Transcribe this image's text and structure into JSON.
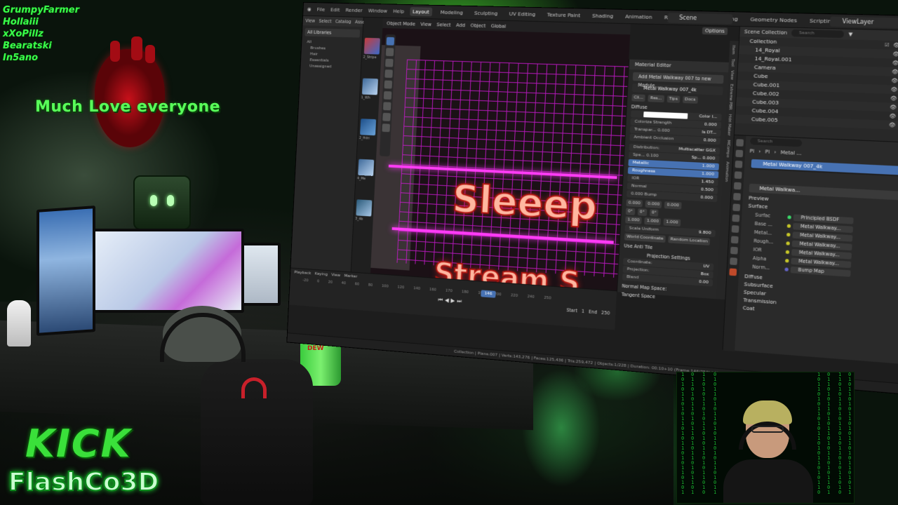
{
  "overlay": {
    "chat_names": [
      "GrumpyFarmer",
      "Hollaiii",
      "xXoPillz",
      "Bearatski",
      "In5ano"
    ],
    "love_text": "Much Love everyone",
    "logo_top": "KICK",
    "logo_bottom": "FlashCo3D"
  },
  "blender": {
    "menus": [
      "File",
      "Edit",
      "Render",
      "Window",
      "Help"
    ],
    "workspaces": [
      "Layout",
      "Modeling",
      "Sculpting",
      "UV Editing",
      "Texture Paint",
      "Shading",
      "Animation",
      "Rendering",
      "Compositing",
      "Geometry Nodes",
      "Scripting"
    ],
    "active_workspace": "Layout",
    "scene_name": "Scene",
    "view_layer": "ViewLayer",
    "asset_browser": {
      "header_items": [
        "View",
        "Select",
        "Catalog",
        "Asset"
      ],
      "library": "All Libraries",
      "catalogs": [
        {
          "label": "All",
          "indent": false
        },
        {
          "label": "Brushes",
          "indent": true
        },
        {
          "label": "Hair",
          "indent": true
        },
        {
          "label": "Essentials",
          "indent": true
        },
        {
          "label": "Unassigned",
          "indent": true
        }
      ],
      "thumbs": [
        "2_Stripe",
        "1_Wh",
        "2_Hdri",
        "4_Me",
        "3_Ab"
      ]
    },
    "viewport": {
      "header_items": [
        "Object Mode",
        "View",
        "Select",
        "Add",
        "Object"
      ],
      "transform": "Global",
      "options_label": "Options",
      "scene_text_1": "Sleeep",
      "scene_text_2": "Stream S"
    },
    "timeline": {
      "menus": [
        "Playback",
        "Keying",
        "View",
        "Marker"
      ],
      "ruler": [
        "-20",
        "0",
        "20",
        "40",
        "60",
        "80",
        "100",
        "120",
        "140",
        "160",
        "170",
        "180",
        "190",
        "200",
        "220",
        "240",
        "250"
      ],
      "current_frame": "146",
      "start_label": "Start",
      "start_value": "1",
      "end_label": "End",
      "end_value": "250"
    },
    "status_text": "Collection | Plane.007 | Verts:143,276 | Faces:125,436 | Tris:259,472 | Objects:1/228 | Duration: 00:10+10 (Frame 146/250) | Memory: 1.63 GiB | VRAM: 3.9/23.6 GiB | 4.5.1",
    "material_editor": {
      "title": "Material Editor",
      "add_button": "Add Metal Walkway 007 to new Module",
      "material_name": "Metal Walkway 007_4k",
      "chips": [
        "Cli...",
        "Res...",
        "Tips",
        "Docs"
      ],
      "diffuse_label": "Diffuse",
      "color_label": "Color I...",
      "colorize_label": "Colorize Strength",
      "colorize_value": "0.000",
      "transparency_label": "Transpar...",
      "transparency_value": "0.000",
      "is_dt_label": "Is DT...",
      "ao_label": "Ambient Occlusion",
      "ao_value": "0.000",
      "distribution_label": "Distribution:",
      "distribution_value": "Multiscatter GGX",
      "spec_label": "Spe...",
      "spec_value": "0.100",
      "sp_label": "Sp...",
      "sp_value": "0.000",
      "metallic_label": "Metallic",
      "metallic_value": "1.000",
      "roughness_label": "Roughness",
      "roughness_value": "1.000",
      "ior_label": "IOR",
      "ior_value": "1.450",
      "normal_label": "Normal",
      "normal_value": "0.500",
      "bump_label": "Bump",
      "bump_values": [
        "0.000",
        "0.000"
      ],
      "mapping_values": [
        "0.000",
        "0.000",
        "0.000",
        "0°",
        "0°",
        "0°",
        "1.000",
        "1.000",
        "1.000"
      ],
      "scale_uniform_label": "Scale Uniform",
      "scale_uniform_value": "9.800",
      "world_coord_label": "World Coordinate",
      "random_loc_label": "Random Location",
      "anti_tile_label": "Use Anti Tile",
      "projection_settings_label": "Projection Settings",
      "coordinate_label": "Coordinate:",
      "coordinate_value": "UV",
      "projection_label": "Projection:",
      "projection_value": "Box",
      "blend_label": "Blend",
      "blend_value": "0.00",
      "normal_map_space_label": "Normal Map Space:",
      "tangent_space_label": "Tangent Space"
    },
    "side_tabs": [
      "Item",
      "Tool",
      "View",
      "Extreme PBR",
      "Hdri Maker",
      "MCompo",
      "Animation"
    ],
    "outliner": {
      "title": "Scene Collection",
      "search_placeholder": "Search",
      "rows": [
        {
          "label": "Collection",
          "active": false
        },
        {
          "label": "14_Royal",
          "active": false
        },
        {
          "label": "14_Royal.001",
          "active": false
        },
        {
          "label": "Camera",
          "active": false
        },
        {
          "label": "Cube",
          "active": false
        },
        {
          "label": "Cube.001",
          "active": false
        },
        {
          "label": "Cube.002",
          "active": false
        },
        {
          "label": "Cube.003",
          "active": false
        },
        {
          "label": "Cube.004",
          "active": false
        },
        {
          "label": "Cube.005",
          "active": false
        }
      ]
    },
    "properties": {
      "search_placeholder": "Search",
      "path": [
        "Pl",
        "Pl",
        "Metal ..."
      ],
      "slot": "Metal Walkway 007_4k",
      "material_selector": "Metal Walkwa...",
      "preview_label": "Preview",
      "surface_label": "Surface",
      "surface_field": "Surfac",
      "surface_node": "Principled BSDF",
      "inputs": [
        {
          "label": "Base ...",
          "link": "Metal Walkway..."
        },
        {
          "label": "Metal...",
          "link": "Metal Walkway..."
        },
        {
          "label": "Rough...",
          "link": "Metal Walkway..."
        },
        {
          "label": "IOR",
          "link": "Metal Walkway..."
        },
        {
          "label": "Alpha",
          "link": "Metal Walkway..."
        },
        {
          "label": "Norm...",
          "link": "Bump Map"
        }
      ],
      "subsections": [
        "Diffuse",
        "Subsurface",
        "Specular",
        "Transmission",
        "Coat"
      ]
    }
  },
  "colors": {
    "neon_green": "#39ff4a",
    "blender_blue": "#4772b3",
    "neon_pink": "#d21ad8"
  }
}
